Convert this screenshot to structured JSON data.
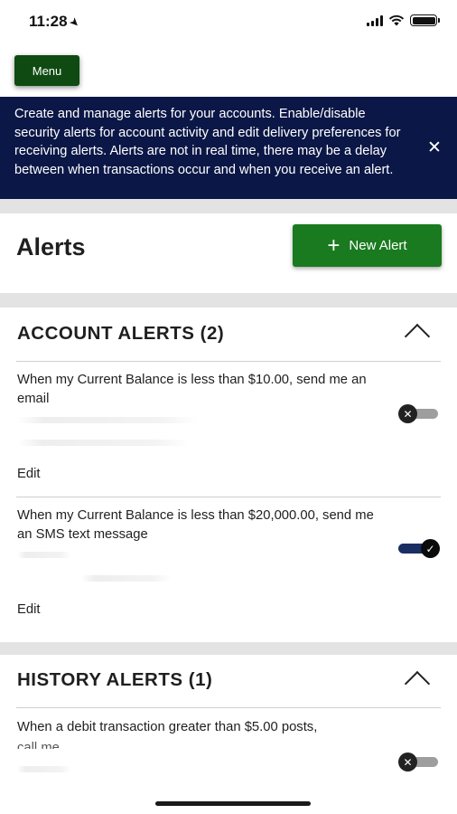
{
  "status_bar": {
    "time": "11:28"
  },
  "menu": {
    "label": "Menu"
  },
  "banner": {
    "text": "Create and manage alerts for your accounts. Enable/disable security alerts for account activity and edit delivery preferences for receiving alerts. Alerts are not in real time, there may be a delay between when transactions occur and when you receive an alert.",
    "close_symbol": "✕"
  },
  "page": {
    "title": "Alerts",
    "new_alert_label": "New Alert",
    "new_alert_icon": "+"
  },
  "account_alerts": {
    "title": "ACCOUNT ALERTS (2)",
    "items": [
      {
        "text": "When my Current Balance is less than $10.00, send me an email",
        "edit_label": "Edit",
        "enabled": false,
        "toggle_glyph": "✕"
      },
      {
        "text": "When my Current Balance is less than $20,000.00, send me an SMS text message",
        "edit_label": "Edit",
        "enabled": true,
        "toggle_glyph": "✓"
      }
    ]
  },
  "history_alerts": {
    "title": "HISTORY ALERTS (1)",
    "items": [
      {
        "text": "When a debit transaction greater than $5.00 posts,",
        "text_partial": "call me",
        "enabled": false,
        "toggle_glyph": "✕"
      }
    ]
  },
  "colors": {
    "banner_bg": "#0b1746",
    "menu_bg": "#0f4a12",
    "primary_button": "#1a7a1f",
    "toggle_on_track": "#1b2e63",
    "section_gap": "#e3e3e3"
  }
}
